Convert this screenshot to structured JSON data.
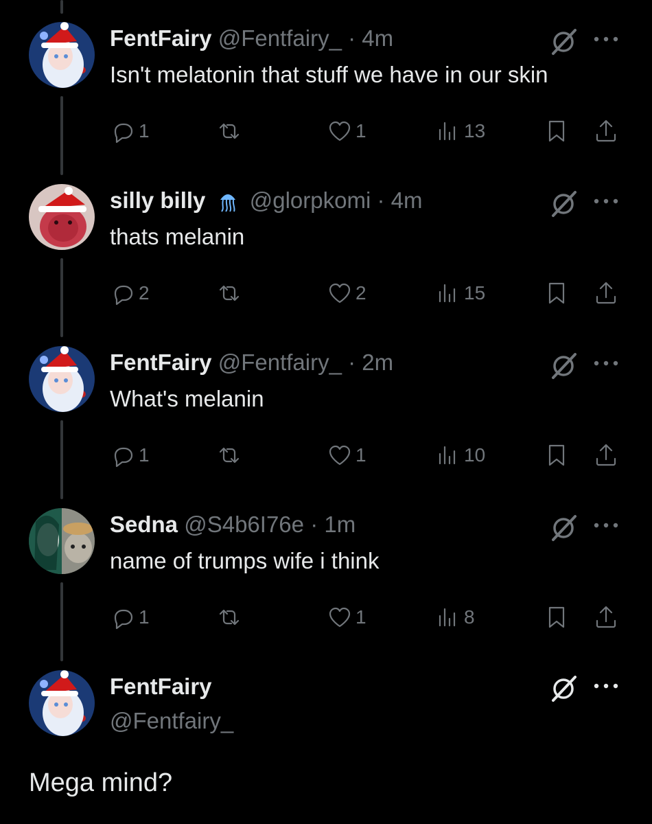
{
  "tweets": [
    {
      "name": "FentFairy",
      "handle": "@Fentfairy_",
      "time": "4m",
      "text": "Isn't melatonin that stuff we have in our skin",
      "replies": "1",
      "likes": "1",
      "views": "13",
      "avatar": "fentfairy"
    },
    {
      "name": "silly billy",
      "handle": "@glorpkomi",
      "time": "4m",
      "text": "thats melanin",
      "replies": "2",
      "likes": "2",
      "views": "15",
      "avatar": "sillybilly"
    },
    {
      "name": "FentFairy",
      "handle": "@Fentfairy_",
      "time": "2m",
      "text": "What's melanin",
      "replies": "1",
      "likes": "1",
      "views": "10",
      "avatar": "fentfairy"
    },
    {
      "name": "Sedna",
      "handle": "@S4b6I76e",
      "time": "1m",
      "text": "name of trumps wife i think",
      "replies": "1",
      "likes": "1",
      "views": "8",
      "avatar": "sedna"
    }
  ],
  "main_tweet": {
    "name": "FentFairy",
    "handle": "@Fentfairy_",
    "text": "Mega mind?"
  },
  "separator": "·",
  "colors": {
    "background": "#000000",
    "text": "#e7e9ea",
    "muted": "#71767b",
    "thread_line": "#333639"
  }
}
